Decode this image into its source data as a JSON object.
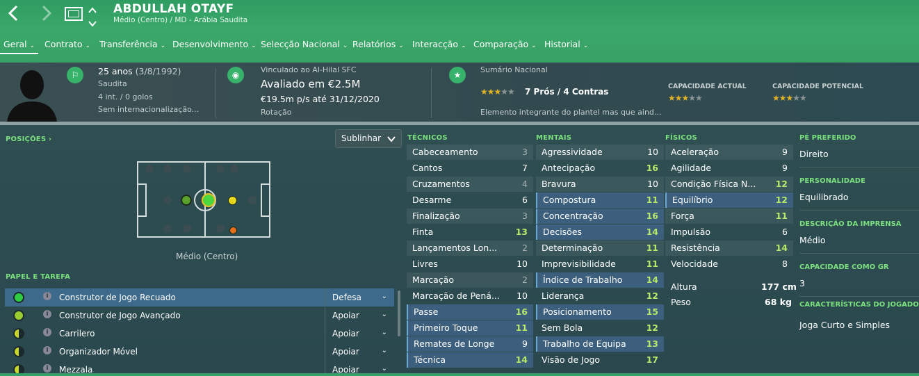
{
  "header": {
    "player_name": "ABDULLAH OTAYF",
    "subtitle": "Médio (Centro) / MD - Arábia Saudita",
    "back_icon": "chevron-left-icon",
    "forward_icon": "chevron-right-icon"
  },
  "tabs": [
    "Geral",
    "Contrato",
    "Transferência",
    "Desenvolvimento",
    "Selecção Nacional",
    "Relatórios",
    "Interacção",
    "Comparação",
    "Historial"
  ],
  "info": {
    "age": "25 anos",
    "dob": "(3/8/1992)",
    "nationality": "Saudita",
    "caps": "4 int. / 0 golos",
    "intl": "Sem internacionalização...",
    "club_label": "Vinculado ao Al-Hilal SFC",
    "value": "Avaliado em €2.5M",
    "wage": "€19.5m p/s até 31/12/2020",
    "squad_status": "Rotação",
    "summary_label": "Sumário Nacional",
    "summary_stars": 3,
    "pros_cons": "7 Prós / 4 Contras",
    "summary_text": "Elemento integrante do plantel mas que aind...",
    "current_ability_label": "CAPACIDADE ACTUAL",
    "current_ability_stars": 3,
    "potential_ability_label": "CAPACIDADE POTENCIAL",
    "potential_ability_stars": 3
  },
  "positions": {
    "label": "POSIÇÕES ›",
    "dropdown": "Sublinhar",
    "position_name": "Médio (Centro)"
  },
  "roles": {
    "label": "PAPEL E TAREFA",
    "items": [
      {
        "name": "Construtor de Jogo Recuado",
        "duty": "Defesa",
        "color": "#2ecc40"
      },
      {
        "name": "Construtor de Jogo Avançado",
        "duty": "Apoiar",
        "color": "#9acd32"
      },
      {
        "name": "Carrilero",
        "duty": "Apoiar",
        "color": "#c8d62a"
      },
      {
        "name": "Organizador Móvel",
        "duty": "Apoiar",
        "color": "#c8d62a"
      },
      {
        "name": "Mezzala",
        "duty": "Apoiar",
        "color": "#c8d62a"
      }
    ]
  },
  "technical": {
    "label": "TÉCNICOS",
    "items": [
      {
        "name": "Cabeceamento",
        "value": "3"
      },
      {
        "name": "Cantos",
        "value": "7"
      },
      {
        "name": "Cruzamentos",
        "value": "4"
      },
      {
        "name": "Desarme",
        "value": "6"
      },
      {
        "name": "Finalização",
        "value": "3"
      },
      {
        "name": "Finta",
        "value": "13"
      },
      {
        "name": "Lançamentos Lon...",
        "value": "2"
      },
      {
        "name": "Livres",
        "value": "10"
      },
      {
        "name": "Marcação",
        "value": "2"
      },
      {
        "name": "Marcação de Pená...",
        "value": "10"
      },
      {
        "name": "Passe",
        "value": "16"
      },
      {
        "name": "Primeiro Toque",
        "value": "11"
      },
      {
        "name": "Remates de Longe",
        "value": "9"
      },
      {
        "name": "Técnica",
        "value": "14"
      }
    ]
  },
  "mental": {
    "label": "MENTAIS",
    "items": [
      {
        "name": "Agressividade",
        "value": "10"
      },
      {
        "name": "Antecipação",
        "value": "16"
      },
      {
        "name": "Bravura",
        "value": "10"
      },
      {
        "name": "Compostura",
        "value": "11"
      },
      {
        "name": "Concentração",
        "value": "16"
      },
      {
        "name": "Decisões",
        "value": "14"
      },
      {
        "name": "Determinação",
        "value": "11"
      },
      {
        "name": "Imprevisibilidade",
        "value": "11"
      },
      {
        "name": "Índice de Trabalho",
        "value": "14"
      },
      {
        "name": "Liderança",
        "value": "12"
      },
      {
        "name": "Posicionamento",
        "value": "15"
      },
      {
        "name": "Sem Bola",
        "value": "12"
      },
      {
        "name": "Trabalho de Equipa",
        "value": "13"
      },
      {
        "name": "Visão de Jogo",
        "value": "17"
      }
    ]
  },
  "physical": {
    "label": "FÍSICOS",
    "items": [
      {
        "name": "Aceleração",
        "value": "9"
      },
      {
        "name": "Agilidade",
        "value": "9"
      },
      {
        "name": "Condição Física N...",
        "value": "12"
      },
      {
        "name": "Equilíbrio",
        "value": "12"
      },
      {
        "name": "Força",
        "value": "11"
      },
      {
        "name": "Impulsão",
        "value": "6"
      },
      {
        "name": "Resistência",
        "value": "14"
      },
      {
        "name": "Velocidade",
        "value": "8"
      }
    ],
    "height_label": "Altura",
    "height": "177 cm",
    "weight_label": "Peso",
    "weight": "68 kg"
  },
  "side": {
    "foot_label": "PÉ PREFERIDO",
    "foot": "Direito",
    "personality_label": "PERSONALIDADE",
    "personality": "Equilibrado",
    "media_label": "DESCRIÇÃO DA IMPRENSA",
    "media": "Médio",
    "gk_label": "CAPACIDADE COMO GR",
    "gk": "3",
    "traits_label": "CARACTERÍSTICAS DO JOGADOR",
    "traits": "Joga Curto e Simples"
  }
}
